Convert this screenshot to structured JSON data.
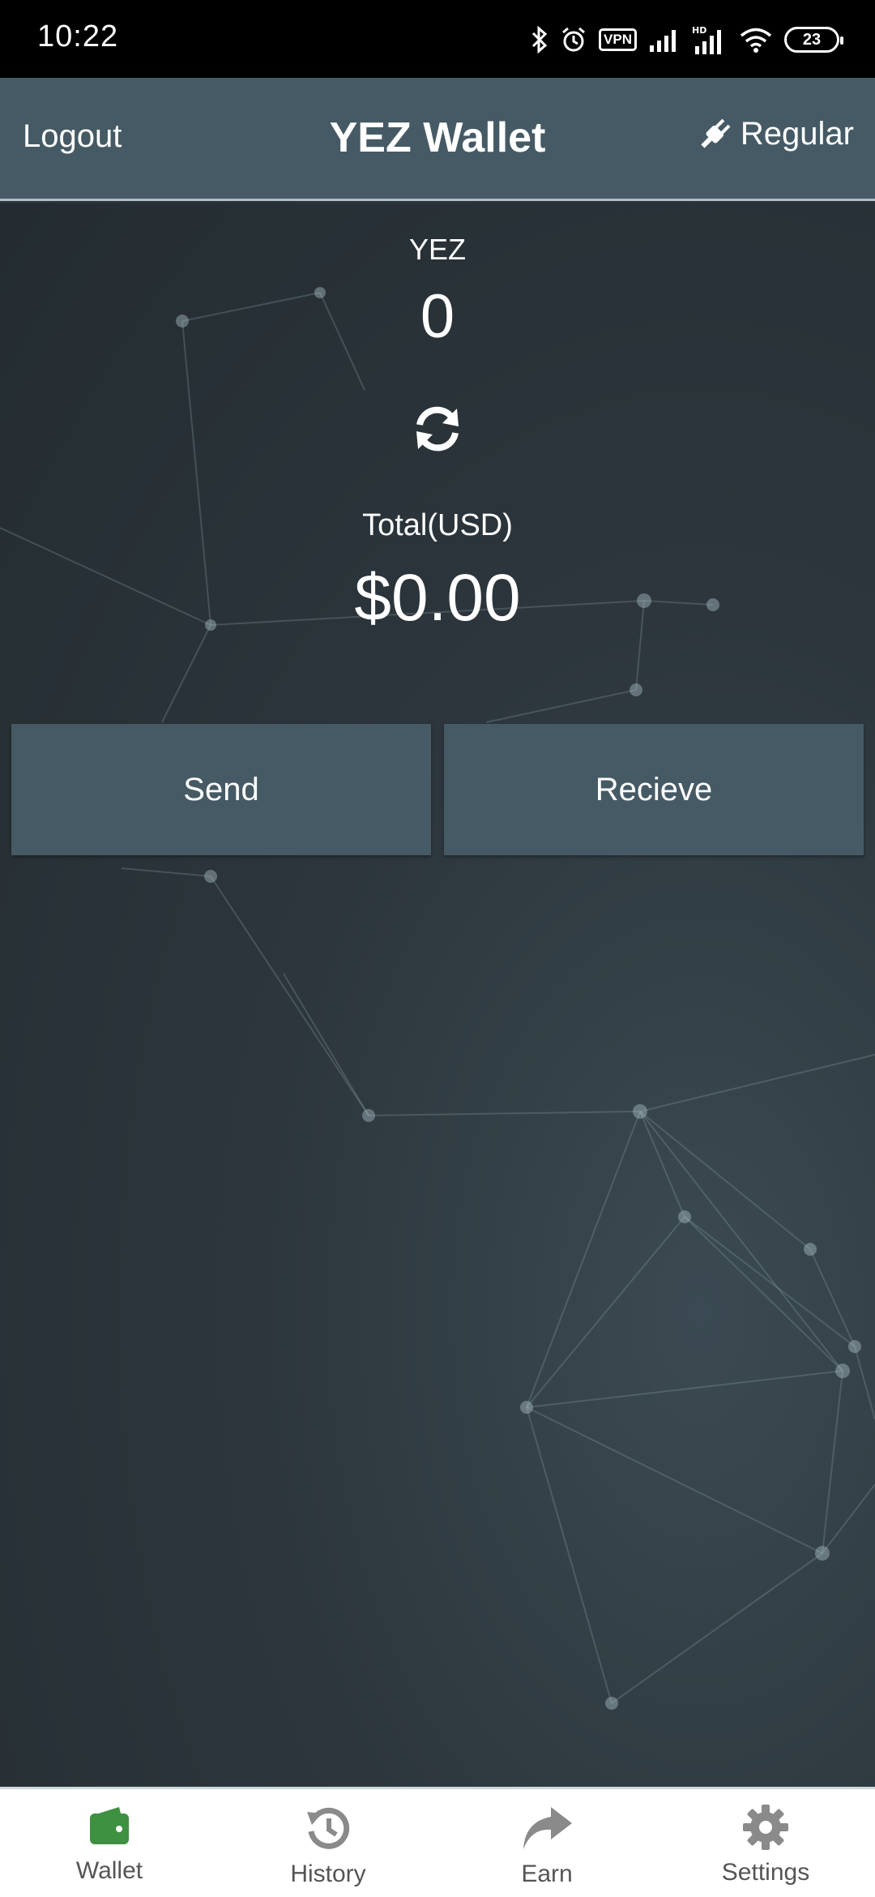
{
  "status_bar": {
    "time": "10:22",
    "vpn": "VPN",
    "battery": "23"
  },
  "header": {
    "logout_label": "Logout",
    "title": "YEZ Wallet",
    "mode_label": "Regular",
    "mode_icon": "plug-icon"
  },
  "balance": {
    "coin_label": "YEZ",
    "coin_amount": "0",
    "refresh_icon": "refresh-icon",
    "total_label": "Total(USD)",
    "total_amount": "$0.00"
  },
  "actions": {
    "send_label": "Send",
    "receive_label": "Recieve"
  },
  "bottom_nav": {
    "items": [
      {
        "label": "Wallet",
        "icon": "wallet-icon",
        "active": true
      },
      {
        "label": "History",
        "icon": "history-icon",
        "active": false
      },
      {
        "label": "Earn",
        "icon": "share-arrow-icon",
        "active": false
      },
      {
        "label": "Settings",
        "icon": "gear-icon",
        "active": false
      }
    ]
  },
  "colors": {
    "header_bg": "#455a64",
    "button_bg": "#455a64",
    "active_icon": "#3d9140",
    "inactive_icon": "#8a8a8a"
  }
}
